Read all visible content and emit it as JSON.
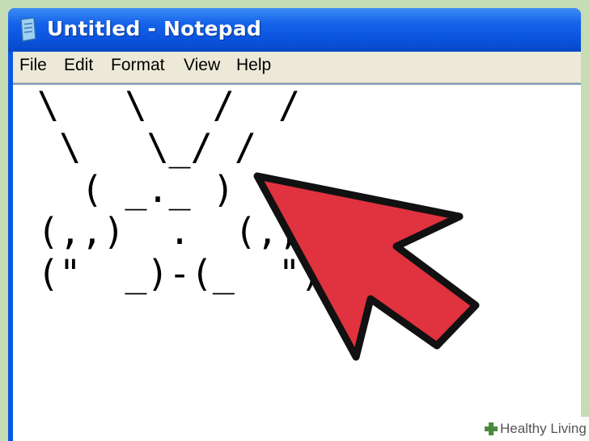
{
  "window": {
    "title": "Untitled - Notepad"
  },
  "menu": {
    "items": [
      "File",
      "Edit",
      "Format",
      "View",
      "Help"
    ]
  },
  "editor": {
    "lines": [
      "\\   \\   /  /",
      " \\   \\_/ /",
      "  ( _._ )",
      "(,,)  .  (,,)",
      "(\"  _)-(_  \")"
    ]
  },
  "watermark": {
    "brand": "Healthy Living"
  },
  "colors": {
    "titlebar": "#0a58e0",
    "arrow": "#e0323f",
    "menubar": "#ece9d8",
    "background": "#c5dcb4"
  }
}
